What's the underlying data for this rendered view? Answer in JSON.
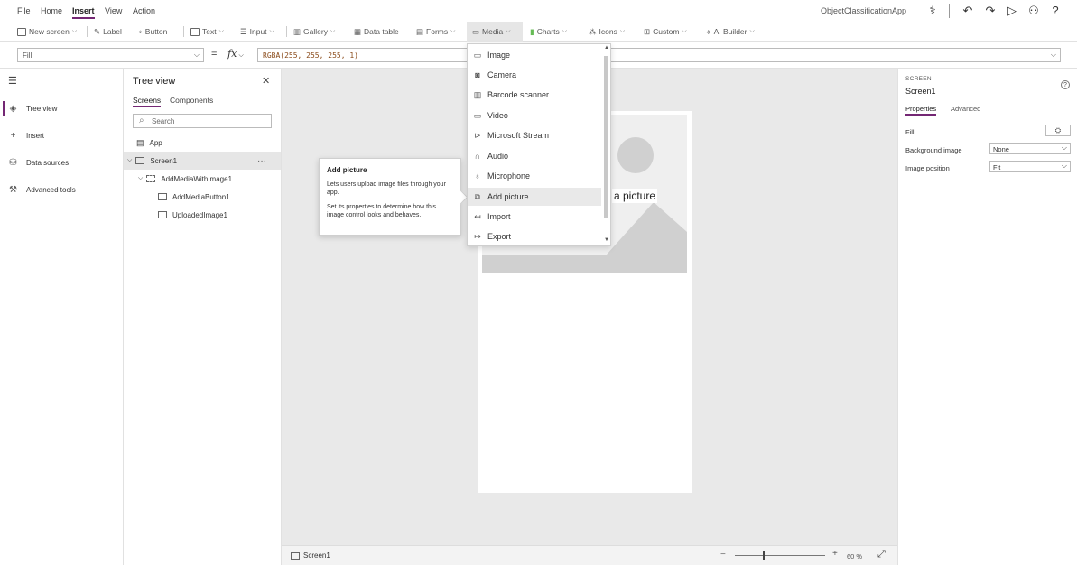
{
  "menubar": {
    "items": [
      "File",
      "Home",
      "Insert",
      "View",
      "Action"
    ],
    "active": "Insert",
    "app_name": "ObjectClassificationApp"
  },
  "toolbar": {
    "new_screen": "New screen",
    "label": "Label",
    "button": "Button",
    "text": "Text",
    "input": "Input",
    "gallery": "Gallery",
    "data_table": "Data table",
    "forms": "Forms",
    "media": "Media",
    "charts": "Charts",
    "icons": "Icons",
    "custom": "Custom",
    "ai_builder": "AI Builder"
  },
  "formula": {
    "property": "Fill",
    "fx": "fx",
    "value": "RGBA(255, 255, 255, 1)"
  },
  "leftnav": {
    "items": [
      "Tree view",
      "Insert",
      "Data sources",
      "Advanced tools"
    ],
    "selected": "Tree view"
  },
  "tree": {
    "title": "Tree view",
    "tabs": [
      "Screens",
      "Components"
    ],
    "search_placeholder": "Search",
    "app": "App",
    "nodes": [
      "Screen1",
      "AddMediaWithImage1",
      "AddMediaButton1",
      "UploadedImage1"
    ]
  },
  "canvas": {
    "image_label": "a picture"
  },
  "status": {
    "screen": "Screen1",
    "zoom": "60 %"
  },
  "props": {
    "type": "SCREEN",
    "name": "Screen1",
    "tabs": [
      "Properties",
      "Advanced"
    ],
    "fill_label": "Fill",
    "bg_image_label": "Background image",
    "bg_image_value": "None",
    "image_position_label": "Image position",
    "image_position_value": "Fit"
  },
  "media_dropdown": {
    "items": [
      "Image",
      "Camera",
      "Barcode scanner",
      "Video",
      "Microsoft Stream",
      "Audio",
      "Microphone",
      "Add picture",
      "Import",
      "Export"
    ],
    "highlighted": "Add picture"
  },
  "tooltip": {
    "title": "Add picture",
    "p1": "Lets users upload image files through your app.",
    "p2": "Set its properties to determine how this image control looks and behaves."
  },
  "colors": {
    "accent": "#742774"
  }
}
